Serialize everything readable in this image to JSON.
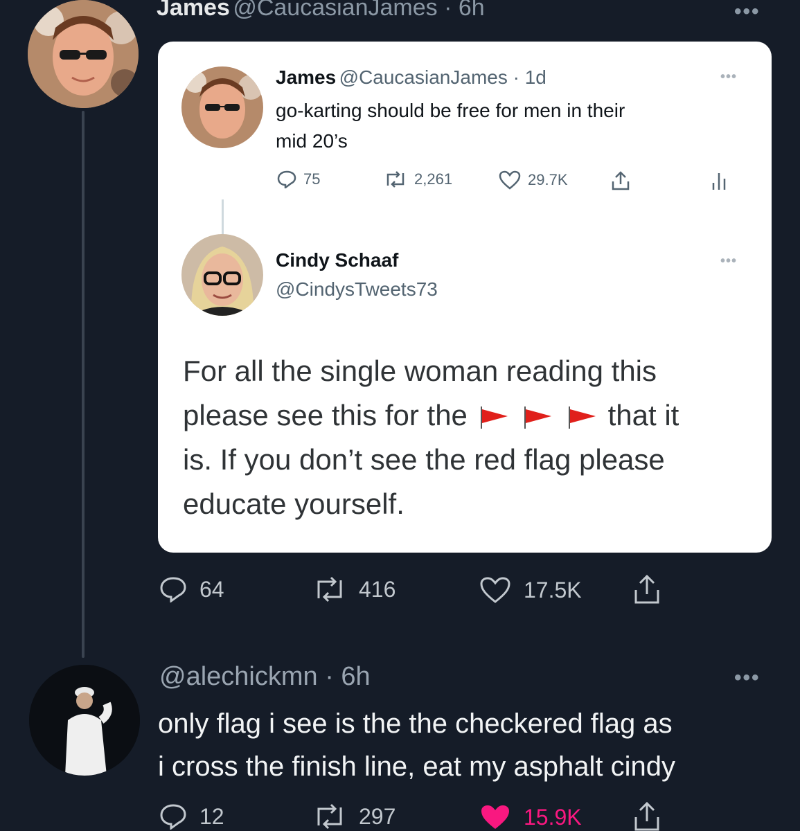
{
  "main_tweet": {
    "name": "James",
    "handle_time": "@CaucasianJames · 6h",
    "more": "•••",
    "actions": {
      "replies": "64",
      "retweets": "416",
      "likes": "17.5K"
    }
  },
  "quoted_thread": {
    "original": {
      "name": "James",
      "handle_time": "@CaucasianJames · 1d",
      "text_line1": "go-karting should be free for men in their",
      "text_line2": "mid 20’s",
      "stats": {
        "replies": "75",
        "retweets": "2,261",
        "likes": "29.7K"
      },
      "more": "•••"
    },
    "reply": {
      "name": "Cindy Schaaf",
      "handle": "@CindysTweets73",
      "more": "•••",
      "line1": "For all the single woman reading this",
      "line2_pre": "please see this for the",
      "line2_post": "that it",
      "line3": "is. If you don’t see the red flag please",
      "line4": "educate yourself."
    }
  },
  "reply_tweet": {
    "handle_time": "@alechickmn · 6h",
    "more": "•••",
    "line1": "only flag i see is the the checkered flag as",
    "line2": "i cross the finish line, eat my asphalt cindy",
    "actions": {
      "replies": "12",
      "retweets": "297",
      "likes": "15.9K"
    },
    "like_color": "#f91880"
  }
}
